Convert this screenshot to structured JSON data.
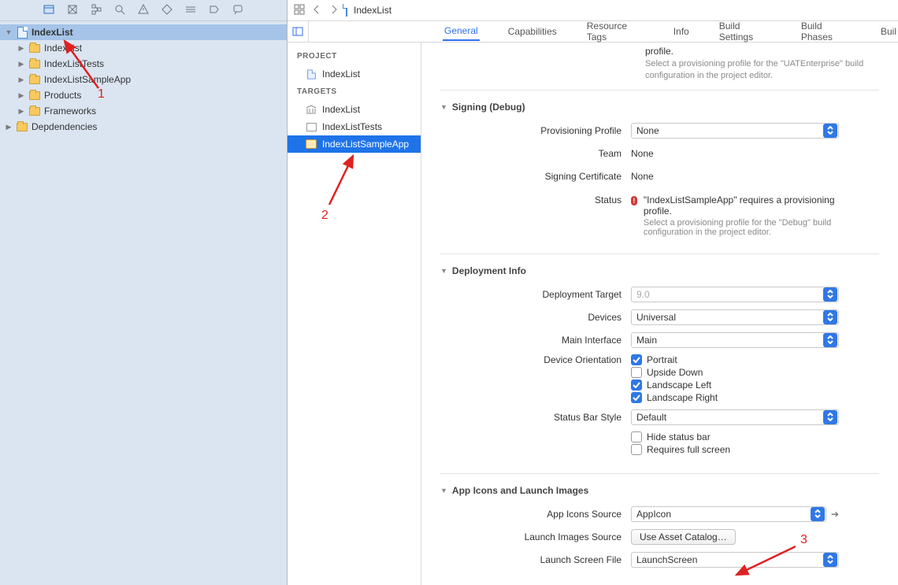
{
  "crumb": {
    "title": "IndexList"
  },
  "navigator": {
    "root": "IndexList",
    "items": [
      "IndexList",
      "IndexListTests",
      "IndexListSampleApp",
      "Products",
      "Frameworks"
    ],
    "second_root": "Depdendencies"
  },
  "project_section": "PROJECT",
  "targets_section": "TARGETS",
  "project_item": "IndexList",
  "targets": [
    "IndexList",
    "IndexListTests",
    "IndexListSampleApp"
  ],
  "tabs": [
    "General",
    "Capabilities",
    "Resource Tags",
    "Info",
    "Build Settings",
    "Build Phases",
    "Buil"
  ],
  "top_note": {
    "line1": "profile.",
    "line2": "Select a provisioning profile for the \"UATEnterprise\" build configuration in the project editor."
  },
  "signing": {
    "header": "Signing (Debug)",
    "prov_label": "Provisioning Profile",
    "prov_value": "None",
    "team_label": "Team",
    "team_value": "None",
    "cert_label": "Signing Certificate",
    "cert_value": "None",
    "status_label": "Status",
    "status_msg": "\"IndexListSampleApp\" requires a provisioning profile.",
    "status_sub": "Select a provisioning profile for the \"Debug\" build configuration in the project editor."
  },
  "deploy": {
    "header": "Deployment Info",
    "target_label": "Deployment Target",
    "target_value": "9.0",
    "devices_label": "Devices",
    "devices_value": "Universal",
    "main_if_label": "Main Interface",
    "main_if_value": "Main",
    "orient_label": "Device Orientation",
    "orient_opts": [
      "Portrait",
      "Upside Down",
      "Landscape Left",
      "Landscape Right"
    ],
    "orient_checked": [
      true,
      false,
      true,
      true
    ],
    "status_style_label": "Status Bar Style",
    "status_style_value": "Default",
    "hide_status": "Hide status bar",
    "req_full": "Requires full screen"
  },
  "icons": {
    "header": "App Icons and Launch Images",
    "source_label": "App Icons Source",
    "source_value": "AppIcon",
    "launch_img_label": "Launch Images Source",
    "launch_img_btn": "Use Asset Catalog…",
    "launch_file_label": "Launch Screen File",
    "launch_file_value": "LaunchScreen"
  },
  "annotations": {
    "n1": "1",
    "n2": "2",
    "n3": "3"
  }
}
